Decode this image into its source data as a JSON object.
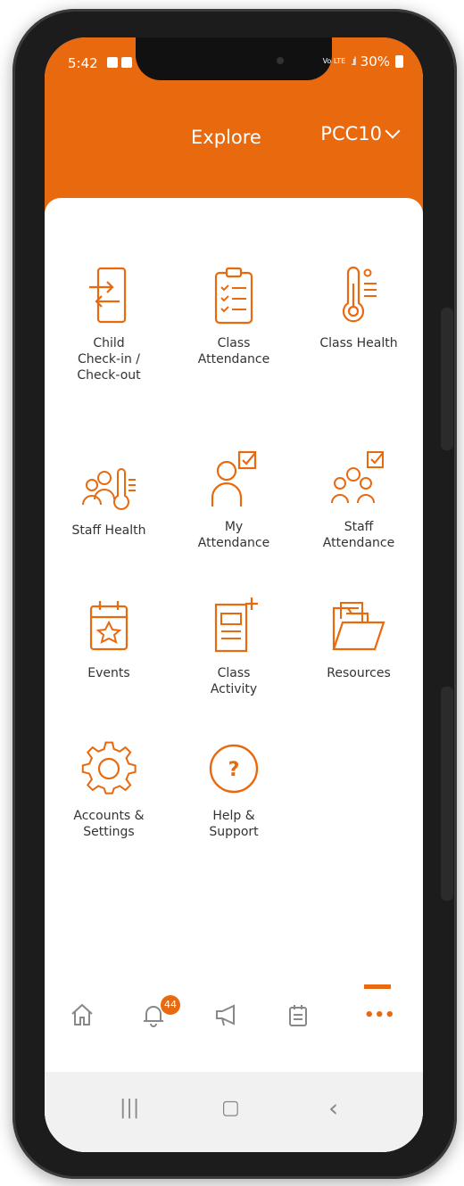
{
  "status_bar": {
    "time": "5:42",
    "network": "Vo LTE",
    "battery": "30%"
  },
  "header": {
    "title": "Explore",
    "organization": "PCC10"
  },
  "tiles": [
    {
      "label": "Child\nCheck-in /\nCheck-out",
      "icon": "check-in-out-icon"
    },
    {
      "label": "Class\nAttendance",
      "icon": "clipboard-checklist-icon"
    },
    {
      "label": "Class Health",
      "icon": "thermometer-icon"
    },
    {
      "label": "Staff Health",
      "icon": "staff-thermometer-icon"
    },
    {
      "label": "My\nAttendance",
      "icon": "person-check-icon"
    },
    {
      "label": "Staff\nAttendance",
      "icon": "group-check-icon"
    },
    {
      "label": "Events",
      "icon": "calendar-star-icon"
    },
    {
      "label": "Class\nActivity",
      "icon": "document-add-icon"
    },
    {
      "label": "Resources",
      "icon": "folder-icon"
    },
    {
      "label": "Accounts &\nSettings",
      "icon": "gear-icon"
    },
    {
      "label": "Help &\nSupport",
      "icon": "help-circle-icon"
    }
  ],
  "bottom_nav": {
    "notifications_count": "44",
    "more_label": "•••"
  },
  "system_nav": {
    "recents": "|||",
    "home": "▢",
    "back": "‹"
  },
  "colors": {
    "accent": "#e9690f",
    "text": "#333333"
  }
}
